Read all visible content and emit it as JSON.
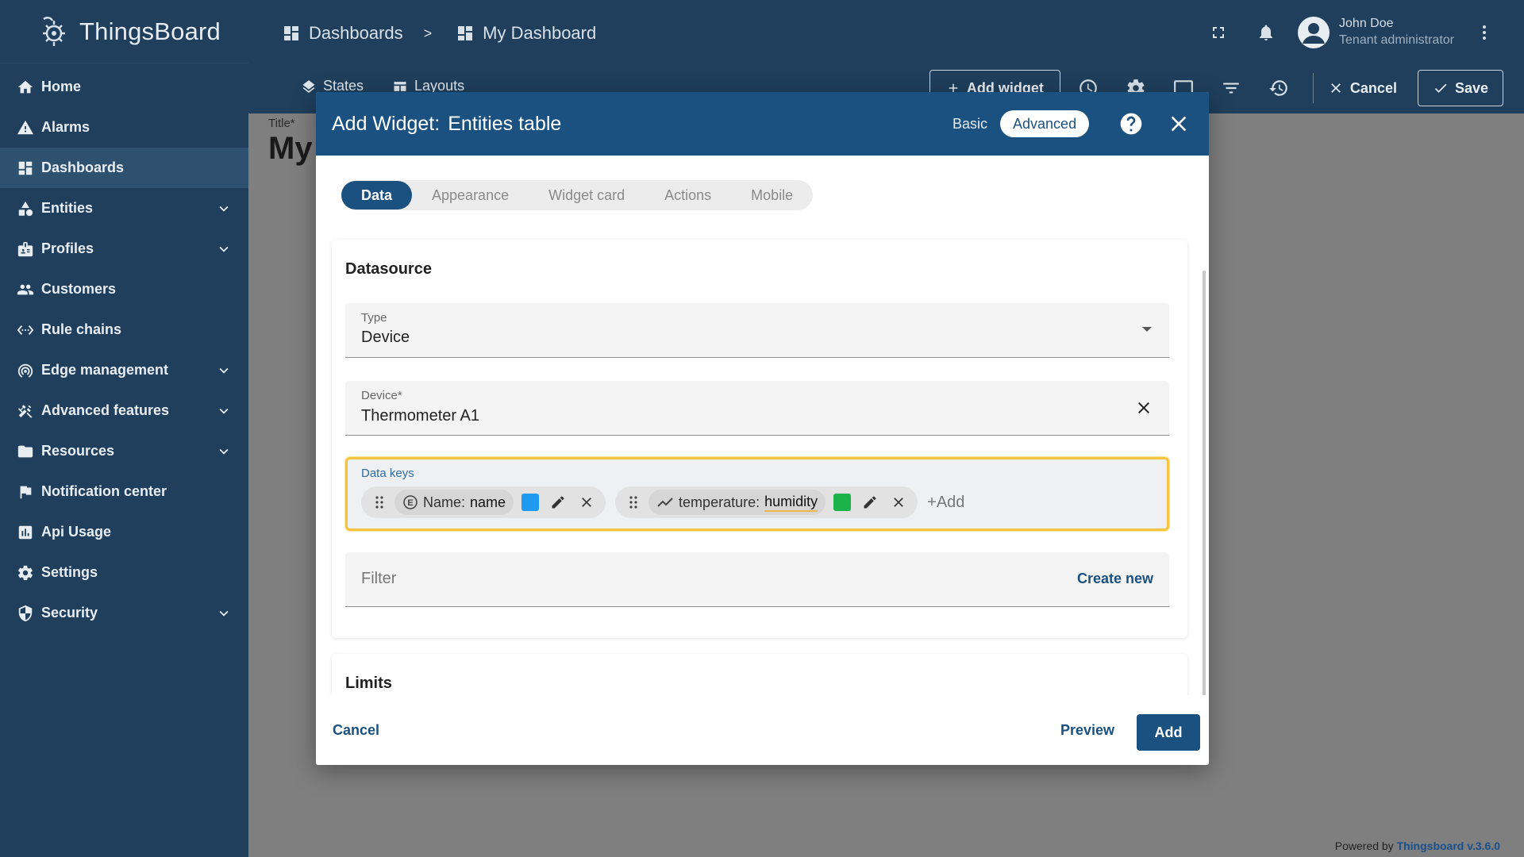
{
  "app": {
    "name": "ThingsBoard"
  },
  "sidebar": {
    "items": [
      {
        "label": "Home",
        "icon": "home-icon",
        "expandable": false,
        "active": false
      },
      {
        "label": "Alarms",
        "icon": "warning-icon",
        "expandable": false,
        "active": false
      },
      {
        "label": "Dashboards",
        "icon": "dashboard-icon",
        "expandable": false,
        "active": true
      },
      {
        "label": "Entities",
        "icon": "category-icon",
        "expandable": true,
        "active": false
      },
      {
        "label": "Profiles",
        "icon": "badge-icon",
        "expandable": true,
        "active": false
      },
      {
        "label": "Customers",
        "icon": "people-icon",
        "expandable": false,
        "active": false
      },
      {
        "label": "Rule chains",
        "icon": "settings-ethernet-icon",
        "expandable": false,
        "active": false
      },
      {
        "label": "Edge management",
        "icon": "router-icon",
        "expandable": true,
        "active": false
      },
      {
        "label": "Advanced features",
        "icon": "construction-icon",
        "expandable": true,
        "active": false
      },
      {
        "label": "Resources",
        "icon": "folder-icon",
        "expandable": true,
        "active": false
      },
      {
        "label": "Notification center",
        "icon": "flag-icon",
        "expandable": false,
        "active": false
      },
      {
        "label": "Api Usage",
        "icon": "insert-chart-icon",
        "expandable": false,
        "active": false
      },
      {
        "label": "Settings",
        "icon": "gear-icon",
        "expandable": false,
        "active": false
      },
      {
        "label": "Security",
        "icon": "shield-icon",
        "expandable": true,
        "active": false
      }
    ]
  },
  "header": {
    "breadcrumb": {
      "root": "Dashboards",
      "separator": ">",
      "current": "My Dashboard"
    },
    "user": {
      "name": "John Doe",
      "role": "Tenant administrator"
    }
  },
  "toolbar": {
    "states_label": "States",
    "layouts_label": "Layouts",
    "add_widget_label": "Add widget",
    "cancel_label": "Cancel",
    "save_label": "Save"
  },
  "dashboard": {
    "title_label": "Title*",
    "title_value": "My",
    "powered_by": "Powered by",
    "powered_link": "Thingsboard v.3.6.0"
  },
  "dialog": {
    "title_prefix": "Add Widget:",
    "widget_name": "Entities table",
    "modes": {
      "basic": "Basic",
      "advanced": "Advanced",
      "selected": "Advanced"
    },
    "tabs": [
      "Data",
      "Appearance",
      "Widget card",
      "Actions",
      "Mobile"
    ],
    "active_tab": "Data",
    "datasource": {
      "section_title": "Datasource",
      "type": {
        "label": "Type",
        "value": "Device"
      },
      "device": {
        "label": "Device*",
        "value": "Thermometer A1"
      },
      "data_keys": {
        "label": "Data keys",
        "keys": [
          {
            "type_icon": "entity-field-icon",
            "prefix": "Name:",
            "key": "name",
            "color": "#1e9bf0"
          },
          {
            "type_icon": "timeseries-icon",
            "prefix": "temperature:",
            "key": "humidity",
            "color": "#1bb34a"
          }
        ],
        "add_placeholder": "+Add"
      },
      "filter": {
        "placeholder": "Filter",
        "create_label": "Create new"
      }
    },
    "limits": {
      "section_title": "Limits"
    },
    "footer": {
      "cancel": "Cancel",
      "preview": "Preview",
      "add": "Add"
    }
  },
  "colors": {
    "sidebar_bg": "#1f3f5c",
    "header_bg": "#1a5180",
    "focus_outline": "#f5c542"
  }
}
